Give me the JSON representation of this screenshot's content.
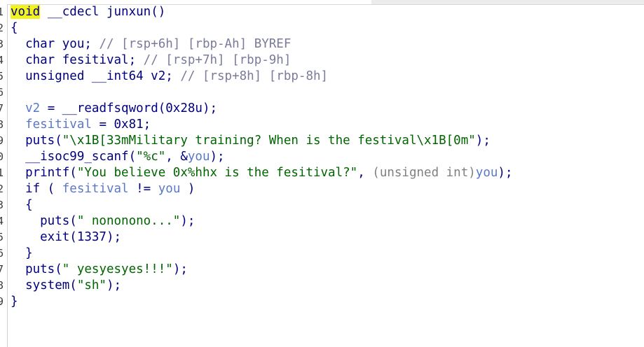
{
  "lines": [
    {
      "n": "1",
      "segs": [
        {
          "t": "void",
          "c": "hl-void"
        },
        {
          "t": " __cdecl junxun()",
          "c": "kw"
        }
      ]
    },
    {
      "n": "2",
      "segs": [
        {
          "t": "{",
          "c": "kw"
        }
      ]
    },
    {
      "n": "3",
      "segs": [
        {
          "t": "  char you; ",
          "c": "kw"
        },
        {
          "t": "// [rsp+6h] [rbp-Ah] BYREF",
          "c": "cmt"
        }
      ]
    },
    {
      "n": "4",
      "segs": [
        {
          "t": "  char fesitival; ",
          "c": "kw"
        },
        {
          "t": "// [rsp+7h] [rbp-9h]",
          "c": "cmt"
        }
      ]
    },
    {
      "n": "5",
      "segs": [
        {
          "t": "  unsigned __int64 v2; ",
          "c": "kw"
        },
        {
          "t": "// [rsp+8h] [rbp-8h]",
          "c": "cmt"
        }
      ]
    },
    {
      "n": "6",
      "segs": []
    },
    {
      "n": "7",
      "segs": [
        {
          "t": "  ",
          "c": "kw"
        },
        {
          "t": "v2",
          "c": "glob"
        },
        {
          "t": " = __readfsqword(0x28u);",
          "c": "kw"
        }
      ]
    },
    {
      "n": "8",
      "segs": [
        {
          "t": "  ",
          "c": "kw"
        },
        {
          "t": "fesitival",
          "c": "glob"
        },
        {
          "t": " = 0x81;",
          "c": "kw"
        }
      ]
    },
    {
      "n": "9",
      "segs": [
        {
          "t": "  puts(",
          "c": "kw"
        },
        {
          "t": "\"\\x1B[33mMilitary training? When is the festival\\x1B[0m\"",
          "c": "str"
        },
        {
          "t": ");",
          "c": "kw"
        }
      ]
    },
    {
      "n": "0",
      "segs": [
        {
          "t": "  __isoc99_scanf(",
          "c": "kw"
        },
        {
          "t": "\"%c\"",
          "c": "str"
        },
        {
          "t": ", &",
          "c": "kw"
        },
        {
          "t": "you",
          "c": "glob"
        },
        {
          "t": ");",
          "c": "kw"
        }
      ]
    },
    {
      "n": "1",
      "segs": [
        {
          "t": "  printf(",
          "c": "kw"
        },
        {
          "t": "\"You believe 0x%hhx is the fesitival?\"",
          "c": "str"
        },
        {
          "t": ", ",
          "c": "kw"
        },
        {
          "t": "(unsigned int)",
          "c": "gray"
        },
        {
          "t": "you",
          "c": "glob"
        },
        {
          "t": ");",
          "c": "kw"
        }
      ]
    },
    {
      "n": "2",
      "segs": [
        {
          "t": "  if ( ",
          "c": "kw"
        },
        {
          "t": "fesitival",
          "c": "glob"
        },
        {
          "t": " != ",
          "c": "kw"
        },
        {
          "t": "you",
          "c": "glob"
        },
        {
          "t": " )",
          "c": "kw"
        }
      ]
    },
    {
      "n": "3",
      "segs": [
        {
          "t": "  {",
          "c": "kw"
        }
      ]
    },
    {
      "n": "4",
      "segs": [
        {
          "t": "    puts(",
          "c": "kw"
        },
        {
          "t": "\" nononono...\"",
          "c": "str"
        },
        {
          "t": ");",
          "c": "kw"
        }
      ]
    },
    {
      "n": "5",
      "segs": [
        {
          "t": "    exit(1337);",
          "c": "kw"
        }
      ]
    },
    {
      "n": "6",
      "segs": [
        {
          "t": "  }",
          "c": "kw"
        }
      ]
    },
    {
      "n": "7",
      "segs": [
        {
          "t": "  puts(",
          "c": "kw"
        },
        {
          "t": "\" yesyesyes!!!\"",
          "c": "str"
        },
        {
          "t": ");",
          "c": "kw"
        }
      ]
    },
    {
      "n": "8",
      "segs": [
        {
          "t": "  system(",
          "c": "kw"
        },
        {
          "t": "\"sh\"",
          "c": "str"
        },
        {
          "t": ");",
          "c": "kw"
        }
      ]
    },
    {
      "n": "9",
      "segs": [
        {
          "t": "}",
          "c": "kw"
        }
      ]
    }
  ]
}
